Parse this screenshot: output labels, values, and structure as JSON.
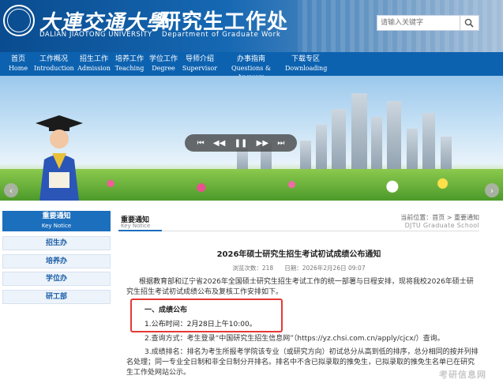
{
  "header": {
    "university_cn": "大連交通大學",
    "university_en": "DALIAN JIAOTONG UNIVERSITY",
    "department_cn": "研究生工作处",
    "department_en": "Department of Graduate Work",
    "search_placeholder": "请输入关键字"
  },
  "nav": [
    {
      "cn": "首页",
      "en": "Home"
    },
    {
      "cn": "工作概况",
      "en": "Introduction"
    },
    {
      "cn": "招生工作",
      "en": "Admission"
    },
    {
      "cn": "培养工作",
      "en": "Teaching"
    },
    {
      "cn": "学位工作",
      "en": "Degree"
    },
    {
      "cn": "导师介绍",
      "en": "Supervisor"
    },
    {
      "cn": "办事指南",
      "en": "Questions & Answers"
    },
    {
      "cn": "下载专区",
      "en": "Downloading"
    }
  ],
  "banner": {
    "controls": [
      "⏮",
      "◀◀",
      "❚❚",
      "▶▶",
      "⏭"
    ],
    "prev": "‹",
    "next": "›"
  },
  "sidebar": {
    "title_cn": "重要通知",
    "title_en": "Key Notice",
    "items": [
      "招生办",
      "培养办",
      "学位办",
      "研工部"
    ]
  },
  "content": {
    "head_cn": "重要通知",
    "head_en": "Key Notice",
    "breadcrumb": "当前位置：首页 > 重要通知",
    "breadcrumb_en": "DJTU Graduate School",
    "title": "2026年硕士研究生招生考试初试成绩公布通知",
    "views": "浏览次数：218",
    "date": "日期：2026年2月26日 09:07",
    "para1": "根据教育部和辽宁省2026年全国硕士研究生招生考试工作的统一部署与日程安排，现将我校2026年硕士研究生招生考试初试成绩公布及复核工作安排如下。",
    "section1": "一、成绩公布",
    "item1": "1.公布时间：2月28日上午10:00。",
    "item2": "2.查询方式：考生登录“中国研究生招生信息网”（https://yz.chsi.com.cn/apply/cjcx/）查询。",
    "item3": "3.成绩排名：排名为考生所报考学院该专业（或研究方向）初试总分从高到低的排序，总分相同的按并列排名处理；同一专业全日制和非全日制分开排名。排名中不含已拟录取的推免生，已拟录取的推免生名单已在研究生工作处网站公示。"
  },
  "watermark": "考研信息网"
}
